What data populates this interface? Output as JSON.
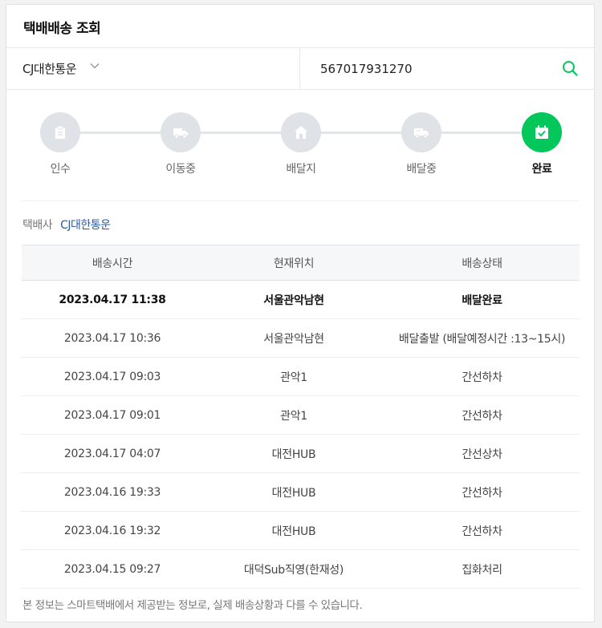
{
  "header": {
    "title": "택배배송 조회"
  },
  "search": {
    "carrier": "CJ대한통운",
    "tracking_number": "567017931270",
    "search_icon": "search-icon",
    "chevron_icon": "chevron-down-icon"
  },
  "progress": {
    "steps": [
      {
        "label": "인수",
        "icon": "clipboard-icon",
        "active": false
      },
      {
        "label": "이동중",
        "icon": "truck-icon",
        "active": false
      },
      {
        "label": "배달지",
        "icon": "house-icon",
        "active": false
      },
      {
        "label": "배달중",
        "icon": "delivery-truck-icon",
        "active": false
      },
      {
        "label": "완료",
        "icon": "calendar-check-icon",
        "active": true
      }
    ],
    "active_color": "#03c75a",
    "inactive_color": "#dfe2e6"
  },
  "carrier_info": {
    "label": "택배사",
    "value": "CJ대한통운"
  },
  "table": {
    "headers": [
      "배송시간",
      "현재위치",
      "배송상태"
    ],
    "rows": [
      [
        "2023.04.17 11:38",
        "서울관악남현",
        "배달완료"
      ],
      [
        "2023.04.17 10:36",
        "서울관악남현",
        "배달출발 (배달예정시간 :13~15시)"
      ],
      [
        "2023.04.17 09:03",
        "관악1",
        "간선하차"
      ],
      [
        "2023.04.17 09:01",
        "관악1",
        "간선하차"
      ],
      [
        "2023.04.17 04:07",
        "대전HUB",
        "간선상차"
      ],
      [
        "2023.04.16 19:33",
        "대전HUB",
        "간선하차"
      ],
      [
        "2023.04.16 19:32",
        "대전HUB",
        "간선하차"
      ],
      [
        "2023.04.15 09:27",
        "대덕Sub직영(한재성)",
        "집화처리"
      ]
    ]
  },
  "footer": {
    "notice": "본 정보는 스마트택배에서 제공받는 정보로, 실제 배송상황과 다를 수 있습니다."
  }
}
